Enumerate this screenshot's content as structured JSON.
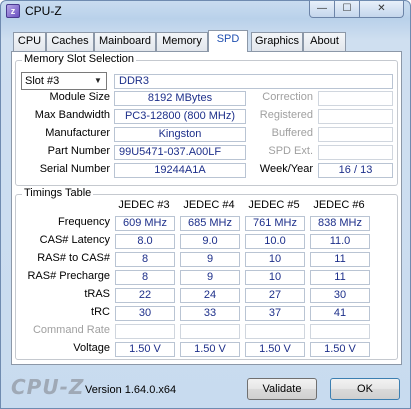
{
  "window": {
    "title": "CPU-Z",
    "icon": "cpu-z-app-icon"
  },
  "controls": {
    "minimize": "—",
    "maximize": "☐",
    "close": "✕"
  },
  "tabs": [
    {
      "label": "CPU",
      "active": false
    },
    {
      "label": "Caches",
      "active": false
    },
    {
      "label": "Mainboard",
      "active": false
    },
    {
      "label": "Memory",
      "active": false
    },
    {
      "label": "SPD",
      "active": true
    },
    {
      "label": "Graphics",
      "active": false
    },
    {
      "label": "About",
      "active": false
    }
  ],
  "slot": {
    "group_title": "Memory Slot Selection",
    "selected": "Slot #3",
    "type": "DDR3",
    "labels": {
      "module_size": "Module Size",
      "max_bandwidth": "Max Bandwidth",
      "manufacturer": "Manufacturer",
      "part_number": "Part Number",
      "serial_number": "Serial Number",
      "correction": "Correction",
      "registered": "Registered",
      "buffered": "Buffered",
      "spd_ext": "SPD Ext.",
      "week_year": "Week/Year"
    },
    "values": {
      "module_size": "8192 MBytes",
      "max_bandwidth": "PC3-12800 (800 MHz)",
      "manufacturer": "Kingston",
      "part_number": "99U5471-037.A00LF",
      "serial_number": "19244A1A",
      "correction": "",
      "registered": "",
      "buffered": "",
      "spd_ext": "",
      "week_year": "16 / 13"
    }
  },
  "timings": {
    "group_title": "Timings Table",
    "columns": [
      "JEDEC #3",
      "JEDEC #4",
      "JEDEC #5",
      "JEDEC #6"
    ],
    "rows": [
      {
        "label": "Frequency",
        "values": [
          "609 MHz",
          "685 MHz",
          "761 MHz",
          "838 MHz"
        ],
        "enabled": true
      },
      {
        "label": "CAS# Latency",
        "values": [
          "8.0",
          "9.0",
          "10.0",
          "11.0"
        ],
        "enabled": true
      },
      {
        "label": "RAS# to CAS#",
        "values": [
          "8",
          "9",
          "10",
          "11"
        ],
        "enabled": true
      },
      {
        "label": "RAS# Precharge",
        "values": [
          "8",
          "9",
          "10",
          "11"
        ],
        "enabled": true
      },
      {
        "label": "tRAS",
        "values": [
          "22",
          "24",
          "27",
          "30"
        ],
        "enabled": true
      },
      {
        "label": "tRC",
        "values": [
          "30",
          "33",
          "37",
          "41"
        ],
        "enabled": true
      },
      {
        "label": "Command Rate",
        "values": [
          "",
          "",
          "",
          ""
        ],
        "enabled": false
      },
      {
        "label": "Voltage",
        "values": [
          "1.50 V",
          "1.50 V",
          "1.50 V",
          "1.50 V"
        ],
        "enabled": true
      }
    ]
  },
  "footer": {
    "logo": "CPU-Z",
    "version": "Version 1.64.0.x64",
    "validate_label": "Validate",
    "ok_label": "OK"
  }
}
